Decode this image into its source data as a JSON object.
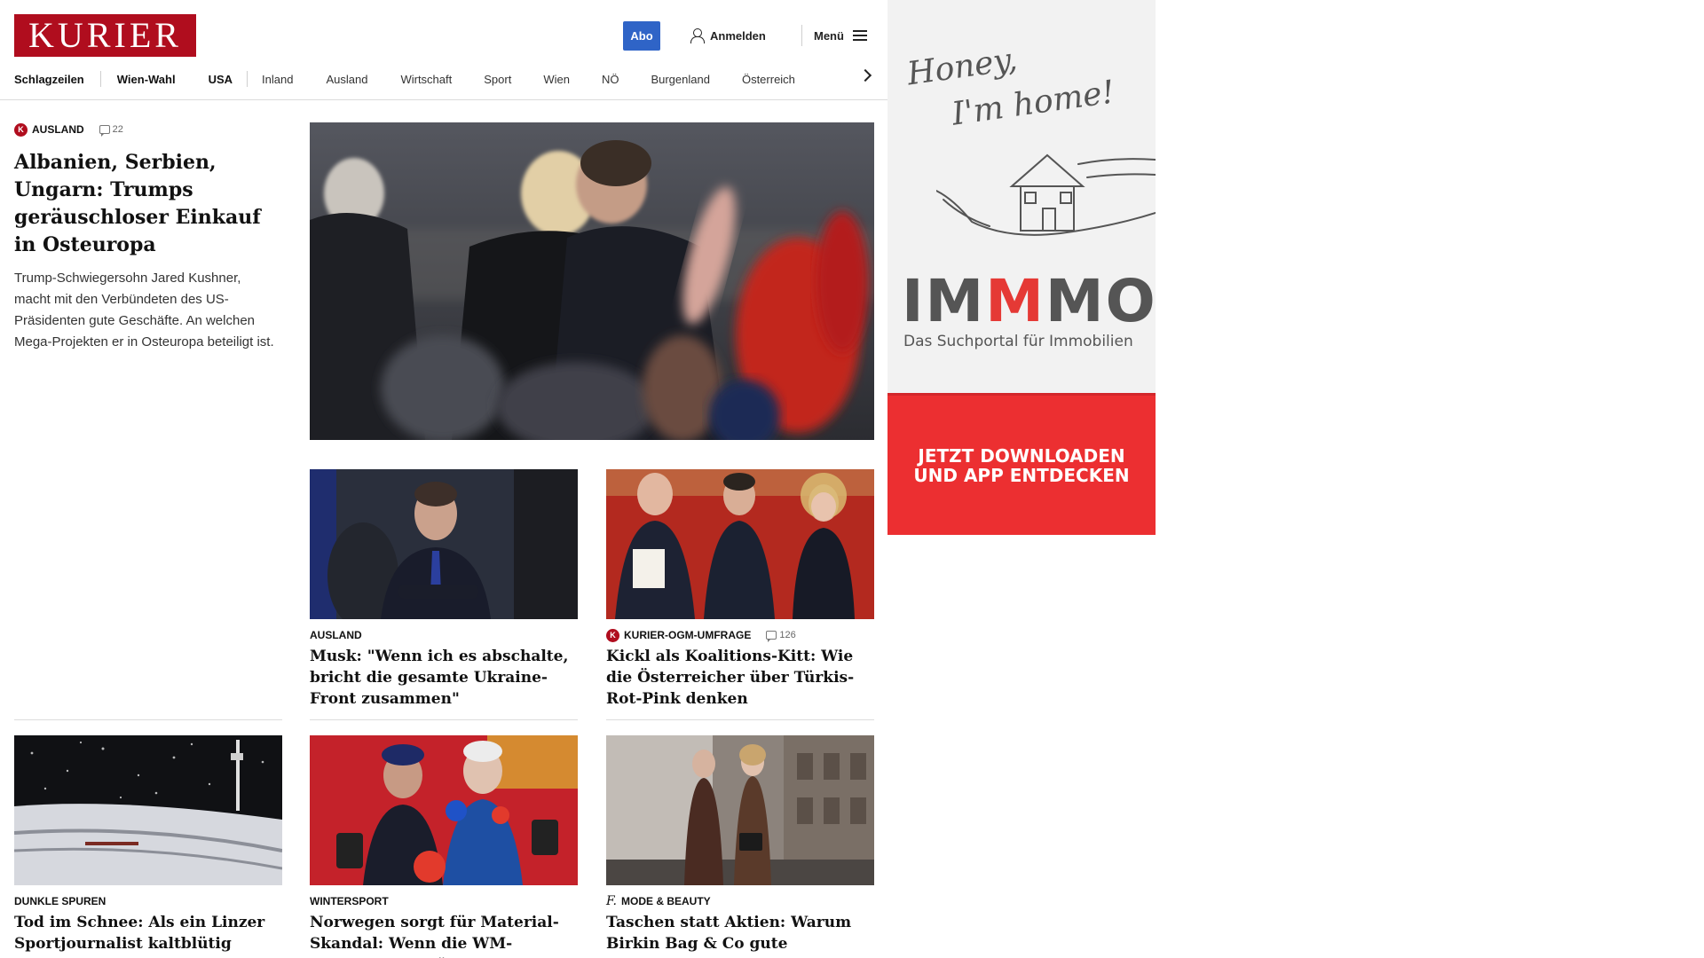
{
  "header": {
    "logo": "KURIER",
    "abo_label": "Abo",
    "login_label": "Anmelden",
    "menu_label": "Menü"
  },
  "nav": {
    "items": [
      "Schlagzeilen",
      "Wien-Wahl",
      "USA",
      "Inland",
      "Ausland",
      "Wirtschaft",
      "Sport",
      "Wien",
      "NÖ",
      "Burgenland",
      "Österreich"
    ]
  },
  "lead": {
    "category": "Ausland",
    "comments": "22",
    "title": "Albanien, Serbien, Ungarn: Trumps geräuschloser Einkauf in Osteuropa",
    "teaser": "Trump-Schwiegersohn Jared Kushner, macht mit den Verbündeten des US-Präsidenten gute Geschäfte. An welchen Mega-Projekten er in Osteuropa beteiligt ist."
  },
  "cards": [
    {
      "category": "Ausland",
      "title": "Musk: \"Wenn ich es abschalte, bricht die gesamte Ukraine-Front zusammen\""
    },
    {
      "category": "Kurier-OGM-Umfrage",
      "comments": "126",
      "title": "Kickl als Koalitions-Kitt: Wie die Österreicher über Türkis-Rot-Pink denken"
    },
    {
      "category": "Dunkle Spuren",
      "title": "Tod im Schnee: Als ein Linzer Sportjournalist kaltblütig ermordet wurde"
    },
    {
      "category": "Wintersport",
      "title": "Norwegen sorgt für Material-Skandal: Wenn die WM-Gastgeber betrügen"
    },
    {
      "category": "Mode & Beauty",
      "title": "Taschen statt Aktien: Warum Birkin Bag & Co gute Wertanlagen sind"
    }
  ],
  "ad": {
    "tagline_1": "Honey,",
    "tagline_2": "I'm home!",
    "brand_1": "IM",
    "brand_2": "M",
    "brand_3": "MO",
    "subtitle": "Das Suchportal für Immobilien",
    "cta_1": "Jetzt downloaden",
    "cta_2": "und App entdecken"
  },
  "colors": {
    "brand_red": "#b00d1e",
    "abo_blue": "#2f64c7",
    "ad_red": "#ec2f31"
  }
}
